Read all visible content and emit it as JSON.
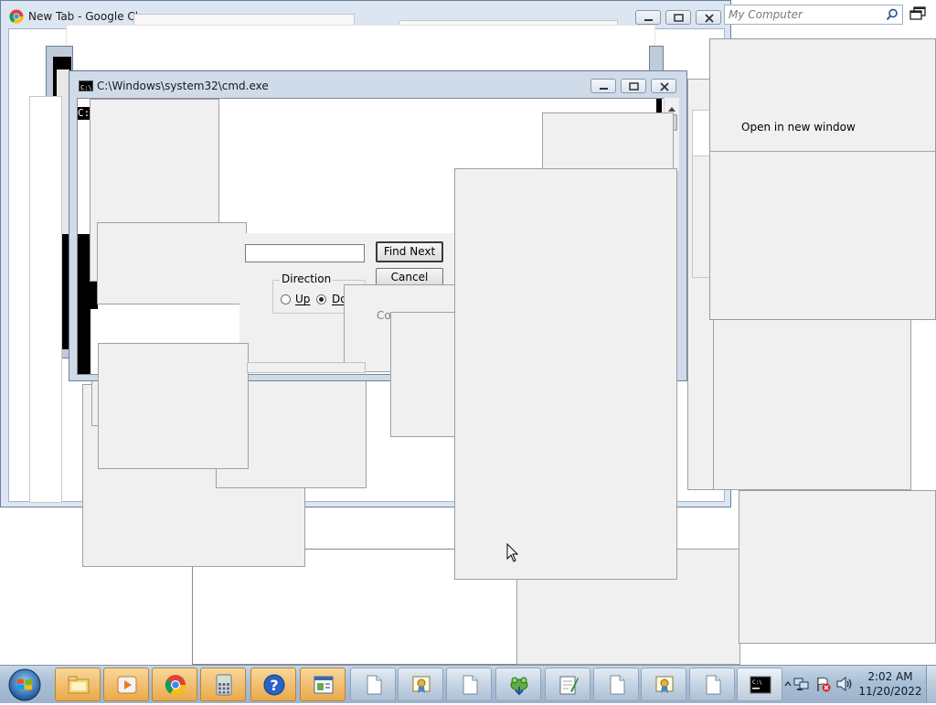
{
  "chrome_window": {
    "title": "New Tab - Google Ch",
    "address_text": "My Computer"
  },
  "cmd_window": {
    "title": "C:\\Windows\\system32\\cmd.exe",
    "prompt_fragment": "C:"
  },
  "find_dialog": {
    "find_next_label": "Find Next",
    "cancel_label": "Cancel",
    "direction_label": "Direction",
    "up_label": "Up",
    "down_label": "Do",
    "selected_direction": "down",
    "partial_text": "Co"
  },
  "context_menu": {
    "open_new_window_label": "Open in new window"
  },
  "taskbar": {
    "start_icon": "windows-orb-icon",
    "buttons": [
      {
        "name": "explorer",
        "icon": "folder-icon"
      },
      {
        "name": "media",
        "icon": "media-player-icon"
      },
      {
        "name": "chrome",
        "icon": "chrome-icon"
      },
      {
        "name": "calculator",
        "icon": "calculator-icon"
      },
      {
        "name": "help",
        "icon": "help-icon"
      },
      {
        "name": "app",
        "icon": "window-app-icon"
      },
      {
        "name": "doc1",
        "icon": "blank-document-icon"
      },
      {
        "name": "cert",
        "icon": "certificate-icon"
      },
      {
        "name": "doc2",
        "icon": "blank-document-icon"
      },
      {
        "name": "frog",
        "icon": "frog-download-icon"
      },
      {
        "name": "notepad",
        "icon": "notepad-pen-icon"
      },
      {
        "name": "doc3",
        "icon": "blank-document-icon"
      },
      {
        "name": "cert2",
        "icon": "certificate-icon"
      },
      {
        "name": "doc4",
        "icon": "blank-document-icon"
      },
      {
        "name": "cmd",
        "icon": "cmd-icon"
      }
    ]
  },
  "tray": {
    "time": "2:02 AM",
    "date": "11/20/2022",
    "icons": [
      "network-icon",
      "flag-error-icon",
      "volume-icon"
    ]
  }
}
